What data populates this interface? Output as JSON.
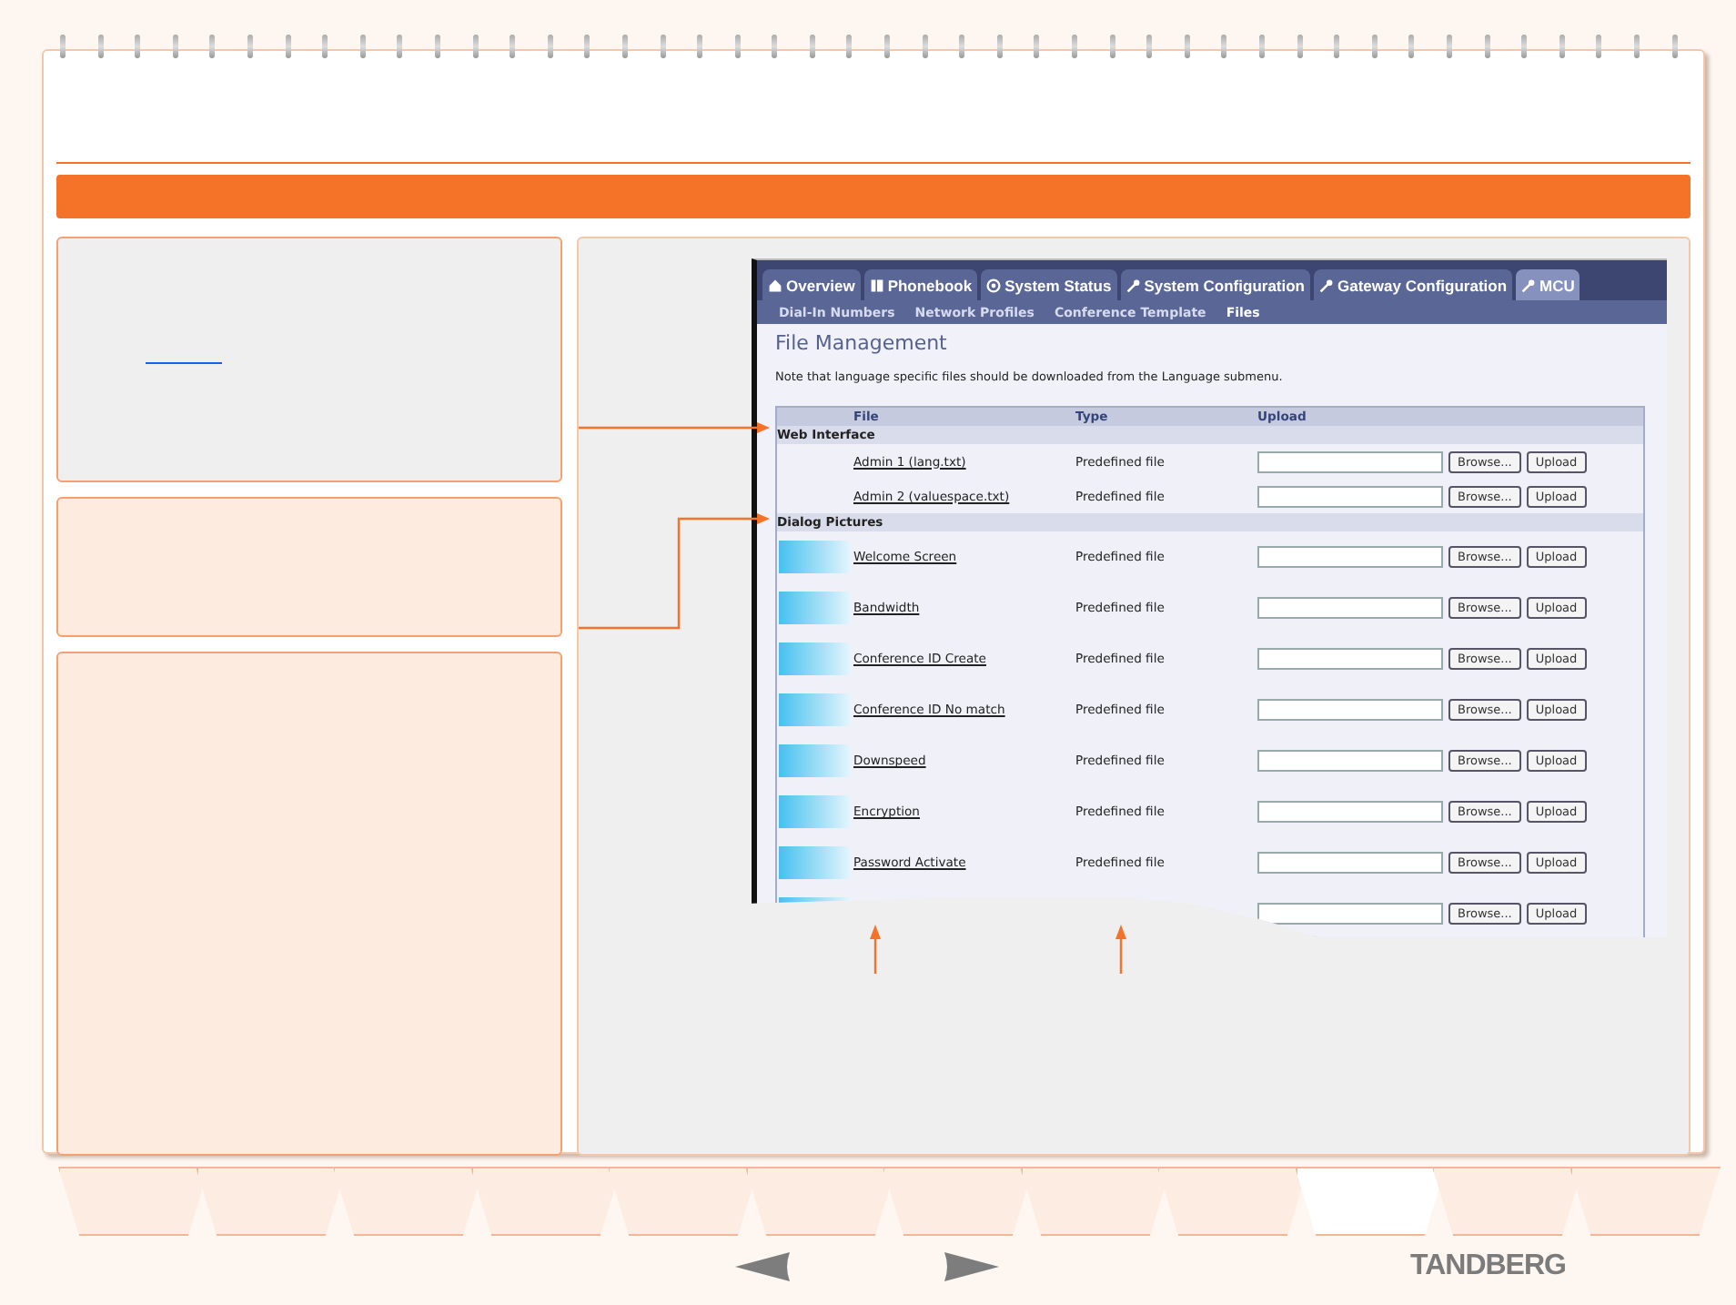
{
  "screenshot": {
    "tabs": [
      {
        "label": "Overview",
        "selected": false
      },
      {
        "label": "Phonebook",
        "selected": false
      },
      {
        "label": "System Status",
        "selected": false
      },
      {
        "label": "System Configuration",
        "selected": false
      },
      {
        "label": "Gateway Configuration",
        "selected": false
      },
      {
        "label": "MCU",
        "selected": true
      }
    ],
    "subtabs": [
      {
        "label": "Dial-In Numbers",
        "selected": false
      },
      {
        "label": "Network Profiles",
        "selected": false
      },
      {
        "label": "Conference Template",
        "selected": false
      },
      {
        "label": "Files",
        "selected": true
      }
    ],
    "title": "File Management",
    "note": "Note that language specific files should be downloaded from the Language submenu.",
    "table": {
      "columns": [
        "File",
        "Type",
        "Upload"
      ],
      "groups": [
        {
          "name": "Web Interface",
          "rows": [
            {
              "kind": "text",
              "file": "Admin 1 (lang.txt)",
              "type": "Predefined file",
              "browse": "Browse...",
              "upload": "Upload"
            },
            {
              "kind": "text",
              "file": "Admin 2 (valuespace.txt)",
              "type": "Predefined file",
              "browse": "Browse...",
              "upload": "Upload"
            }
          ]
        },
        {
          "name": "Dialog Pictures",
          "rows": [
            {
              "kind": "picture",
              "file": "Welcome Screen",
              "type": "Predefined file",
              "browse": "Browse...",
              "upload": "Upload"
            },
            {
              "kind": "picture",
              "file": "Bandwidth",
              "type": "Predefined file",
              "browse": "Browse...",
              "upload": "Upload"
            },
            {
              "kind": "picture",
              "file": "Conference ID Create",
              "type": "Predefined file",
              "browse": "Browse...",
              "upload": "Upload"
            },
            {
              "kind": "picture",
              "file": "Conference ID No match",
              "type": "Predefined file",
              "browse": "Browse...",
              "upload": "Upload"
            },
            {
              "kind": "picture",
              "file": "Downspeed",
              "type": "Predefined file",
              "browse": "Browse...",
              "upload": "Upload"
            },
            {
              "kind": "picture",
              "file": "Encryption",
              "type": "Predefined file",
              "browse": "Browse...",
              "upload": "Upload"
            },
            {
              "kind": "picture",
              "file": "Password Activate",
              "type": "Predefined file",
              "browse": "Browse...",
              "upload": "Upload"
            },
            {
              "kind": "picture",
              "browse": "Browse...",
              "upload": "Upload"
            }
          ]
        }
      ]
    }
  },
  "bottom_tabs": [
    {
      "selected": false
    },
    {
      "selected": false
    },
    {
      "selected": false
    },
    {
      "selected": false
    },
    {
      "selected": false
    },
    {
      "selected": false
    },
    {
      "selected": false
    },
    {
      "selected": false
    },
    {
      "selected": false
    },
    {
      "selected": true
    },
    {
      "selected": false
    },
    {
      "selected": false
    }
  ],
  "logo": "TANDBERG"
}
